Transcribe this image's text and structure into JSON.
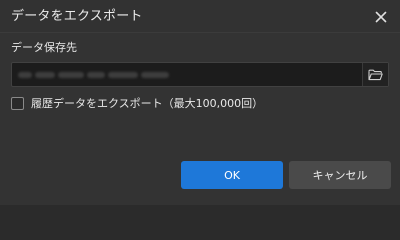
{
  "dialog": {
    "title": "データをエクスポート",
    "close_icon": "close-icon"
  },
  "save_location": {
    "label": "データ保存先",
    "path_value": "",
    "folder_icon": "folder-icon"
  },
  "history_export": {
    "checked": false,
    "label": "履歴データをエクスポート（最大100,000回）"
  },
  "buttons": {
    "ok_label": "OK",
    "cancel_label": "キャンセル"
  },
  "colors": {
    "background": "#333333",
    "input_background": "#1c1c1c",
    "primary_button": "#1e78d9",
    "secondary_button": "#4a4a4a"
  }
}
